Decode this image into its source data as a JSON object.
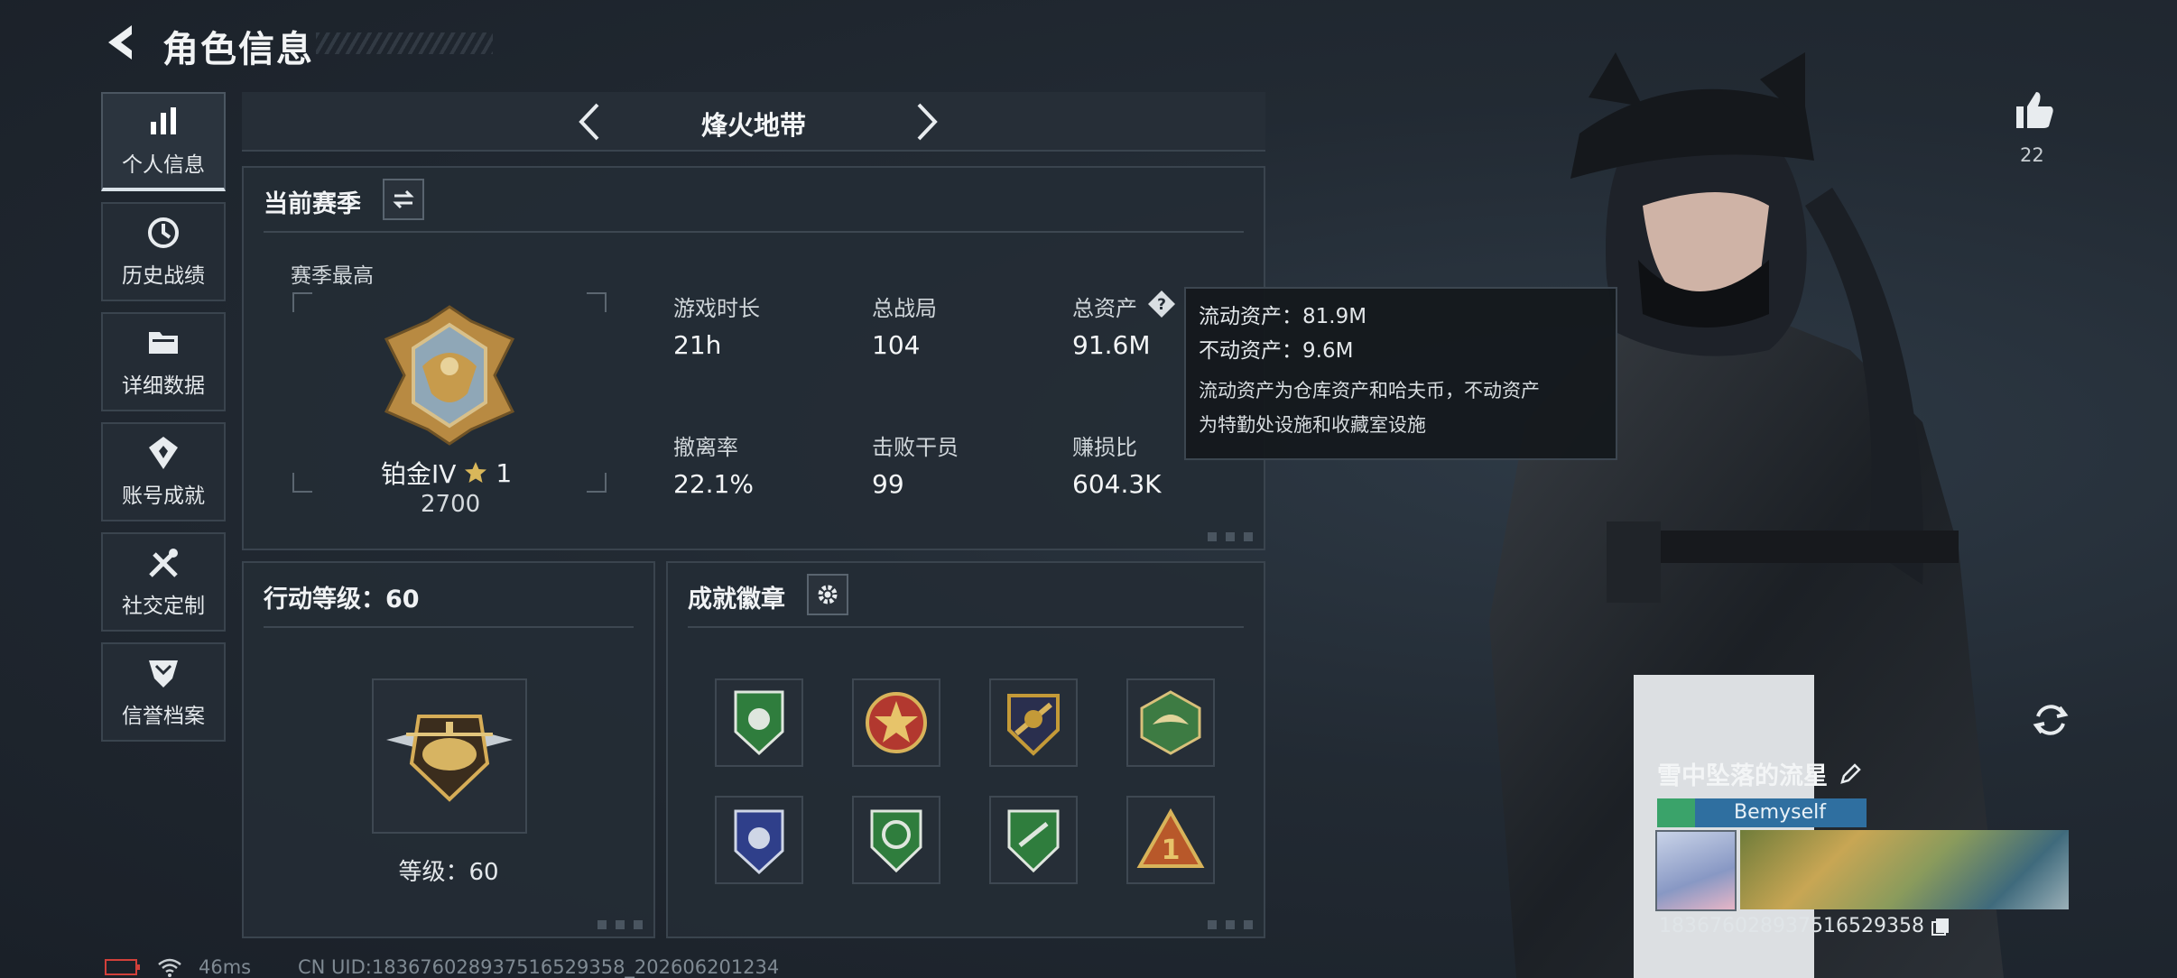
{
  "header": {
    "title": "角色信息"
  },
  "sidebar": {
    "items": [
      {
        "label": "个人信息",
        "icon": "bar-chart-icon",
        "active": true
      },
      {
        "label": "历史战绩",
        "icon": "clock-history-icon",
        "active": false
      },
      {
        "label": "详细数据",
        "icon": "folder-icon",
        "active": false
      },
      {
        "label": "账号成就",
        "icon": "achievement-icon",
        "active": false
      },
      {
        "label": "社交定制",
        "icon": "tools-icon",
        "active": false
      },
      {
        "label": "信誉档案",
        "icon": "shield-rank-icon",
        "active": false
      }
    ]
  },
  "mode_nav": {
    "name": "烽火地带"
  },
  "season": {
    "title": "当前赛季",
    "best_label": "赛季最高",
    "rank": "铂金IV",
    "star_count": "1",
    "score": "2700",
    "stats": [
      {
        "label": "游戏时长",
        "value": "21h"
      },
      {
        "label": "总战局",
        "value": "104"
      },
      {
        "label": "总资产",
        "value": "91.6M"
      },
      {
        "label": "撤离率",
        "value": "22.1%"
      },
      {
        "label": "击败干员",
        "value": "99"
      },
      {
        "label": "赚损比",
        "value": "604.3K"
      }
    ]
  },
  "tooltip": {
    "liquid": "流动资产：81.9M",
    "fixed": "不动资产：9.6M",
    "desc_line1": "流动资产为仓库资产和哈夫币，不动资产",
    "desc_line2": "为特勤处设施和收藏室设施"
  },
  "action_level": {
    "title": "行动等级：60",
    "level_text": "等级：60"
  },
  "badges": {
    "title": "成就徽章",
    "items": [
      {
        "icon": "green-shield-badge-icon",
        "color": "#2f7d3d"
      },
      {
        "icon": "red-star-badge-icon",
        "color": "#b2382f"
      },
      {
        "icon": "gold-crest-badge-icon",
        "color": "#c49a38"
      },
      {
        "icon": "hexagon-eagle-badge-icon",
        "color": "#3d7b43"
      },
      {
        "icon": "blue-shield-badge-icon",
        "color": "#2f3f8a"
      },
      {
        "icon": "green-round-badge-icon",
        "color": "#2f7d3d"
      },
      {
        "icon": "green-round-badge-2-icon",
        "color": "#2f7d3d"
      },
      {
        "icon": "triangle-one-badge-icon",
        "color": "#b8582a"
      }
    ]
  },
  "likes": {
    "count": "22"
  },
  "player": {
    "name": "雪中坠落的流星",
    "title_tag": "Bemyself",
    "uid": "183676028937516529358"
  },
  "status_bar": {
    "ping": "46ms",
    "uid_line": "CN UID:183676028937516529358_202606201234"
  }
}
